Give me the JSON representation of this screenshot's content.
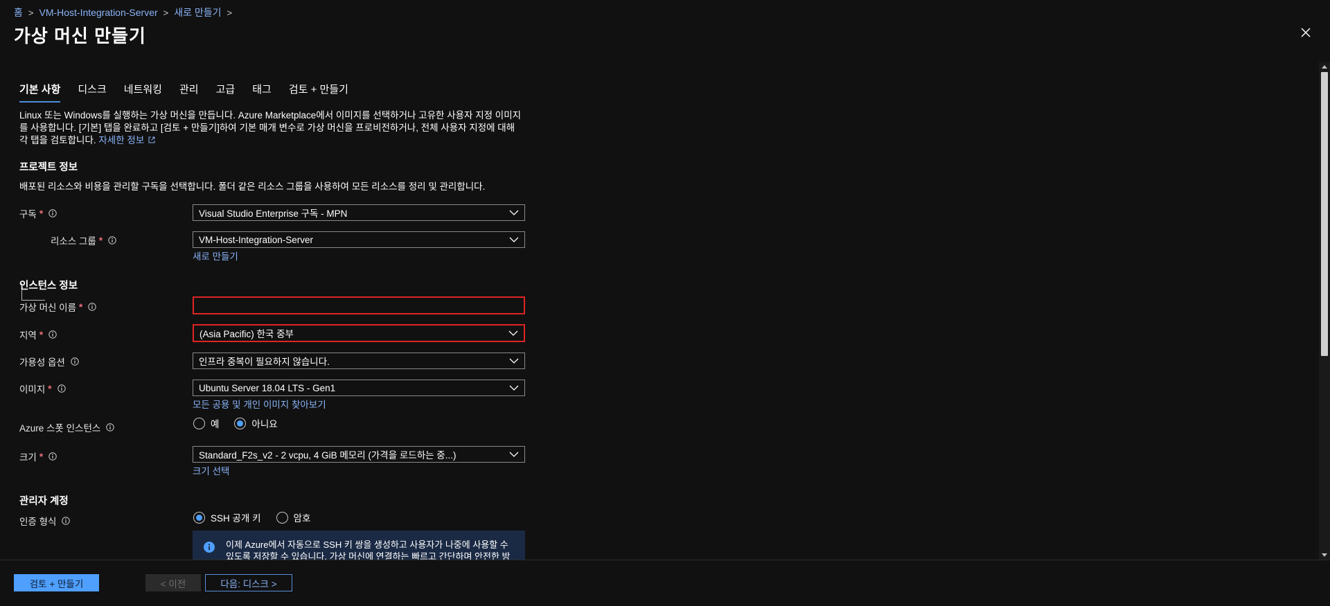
{
  "breadcrumb": {
    "home": "홈",
    "resource_group": "VM-Host-Integration-Server",
    "create_new": "새로 만들기"
  },
  "page_title": "가상 머신 만들기",
  "tabs": [
    {
      "label": "기본 사항",
      "active": true
    },
    {
      "label": "디스크"
    },
    {
      "label": "네트워킹"
    },
    {
      "label": "관리"
    },
    {
      "label": "고급"
    },
    {
      "label": "태그"
    },
    {
      "label": "검토 + 만들기"
    }
  ],
  "intro": {
    "text": "Linux 또는 Windows를 실행하는 가상 머신을 만듭니다. Azure Marketplace에서 이미지를 선택하거나 고유한 사용자 지정 이미지를 사용합니다. [기본] 탭을 완료하고 [검토 + 만들기]하여 기본 매개 변수로 가상 머신을 프로비전하거나, 전체 사용자 지정에 대해 각 탭을 검토합니다.",
    "link": "자세한 정보"
  },
  "project": {
    "title": "프로젝트 정보",
    "description": "배포된 리소스와 비용을 관리할 구독을 선택합니다. 폴더 같은 리소스 그룹을 사용하여 모든 리소스를 정리 및 관리합니다.",
    "subscription_label": "구독",
    "subscription_value": "Visual Studio Enterprise 구독 - MPN",
    "resource_group_label": "리소스 그룹",
    "resource_group_value": "VM-Host-Integration-Server",
    "create_new_link": "새로 만들기"
  },
  "instance": {
    "title": "인스턴스 정보",
    "vm_name_label": "가상 머신 이름",
    "vm_name_value": "",
    "region_label": "지역",
    "region_value": "(Asia Pacific) 한국 중부",
    "availability_label": "가용성 옵션",
    "availability_value": "인프라 중복이 필요하지 않습니다.",
    "image_label": "이미지",
    "image_value": "Ubuntu Server 18.04 LTS - Gen1",
    "image_browse_link": "모든 공용 및 개인 이미지 찾아보기",
    "spot_label": "Azure 스폿 인스턴스",
    "spot_yes": "예",
    "spot_no": "아니요",
    "spot_selected": "아니요",
    "size_label": "크기",
    "size_value": "Standard_F2s_v2 - 2 vcpu, 4 GiB 메모리 (가격을 로드하는 중...)",
    "size_select_link": "크기 선택"
  },
  "admin": {
    "title": "관리자 계정",
    "auth_label": "인증 형식",
    "auth_ssh": "SSH 공개 키",
    "auth_password": "암호",
    "auth_selected": "SSH 공개 키",
    "info_text": "이제 Azure에서 자동으로 SSH 키 쌍을 생성하고 사용자가 나중에 사용할 수 있도록 저장할 수 있습니다. 가상 머신에 연결하는 빠르고 간단하며 안전한 방법입"
  },
  "footer": {
    "review_create": "검토 + 만들기",
    "previous": "< 이전",
    "next": "다음: 디스크 >"
  },
  "colors": {
    "background": "#111111",
    "accent": "#4f9fff",
    "link": "#8ab4f8",
    "error_border": "#e02424",
    "required": "#f1707b",
    "info_bg": "#1b2a44"
  },
  "icons": {
    "close": "close-icon",
    "info": "info-icon",
    "chevron": "chevron-down-icon",
    "external": "external-link-icon"
  }
}
